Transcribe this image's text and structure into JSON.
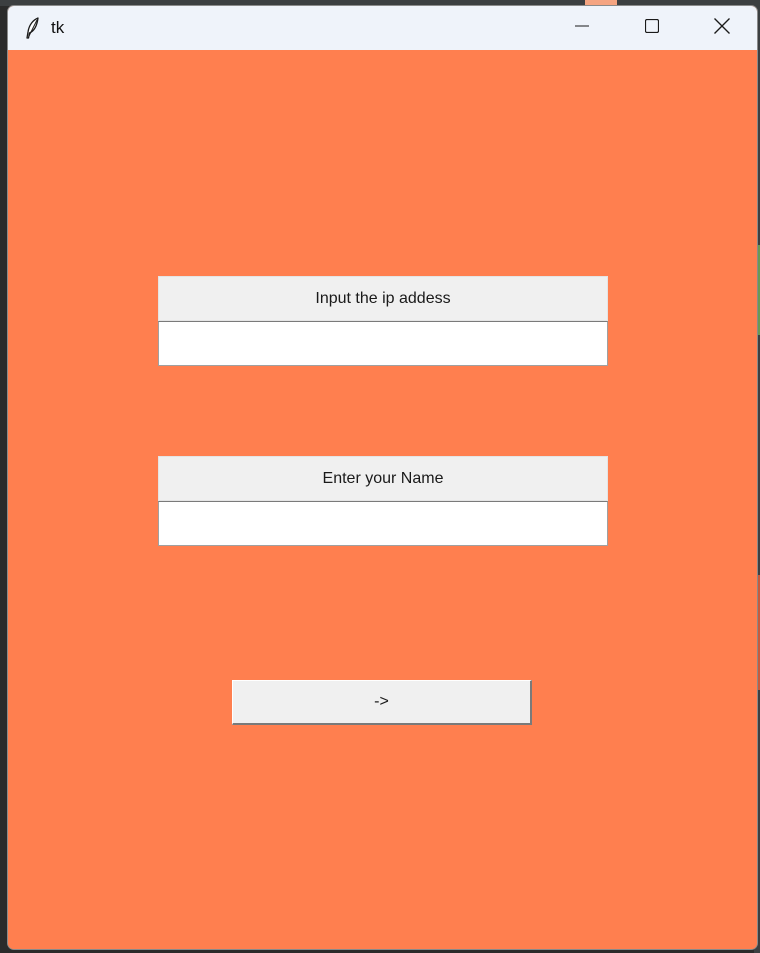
{
  "window": {
    "title": "tk",
    "icon": "feather-icon",
    "background_color": "#ff7f4f",
    "titlebar_color": "#eff3fa"
  },
  "title_controls": {
    "minimize_icon": "minimize-icon",
    "maximize_icon": "maximize-icon",
    "close_icon": "close-icon"
  },
  "ip_field": {
    "label": "Input the ip addess",
    "value": "",
    "placeholder": ""
  },
  "name_field": {
    "label": "Enter your Name",
    "value": "",
    "placeholder": ""
  },
  "submit_button": {
    "label": "->"
  }
}
